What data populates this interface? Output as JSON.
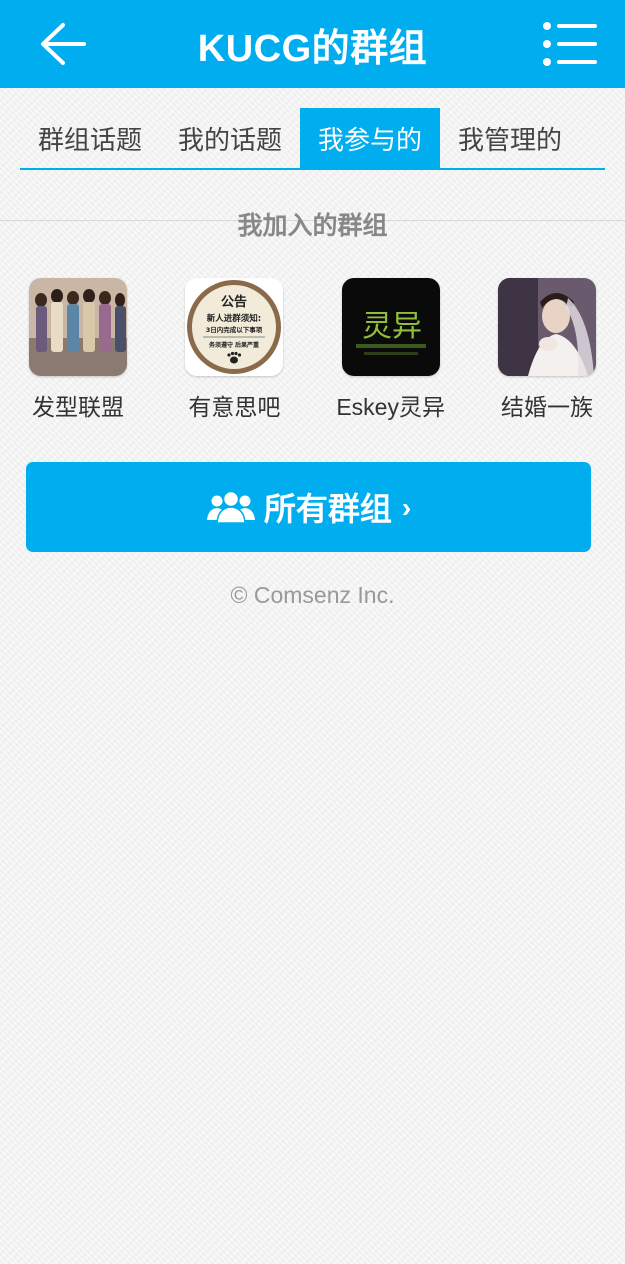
{
  "header": {
    "title": "KUCG的群组",
    "back_icon": "back-arrow-icon",
    "menu_icon": "menu-list-icon"
  },
  "tabs": [
    {
      "label": "群组话题",
      "active": false
    },
    {
      "label": "我的话题",
      "active": false
    },
    {
      "label": "我参与的",
      "active": true
    },
    {
      "label": "我管理的",
      "active": false
    }
  ],
  "section": {
    "title": "我加入的群组"
  },
  "groups": [
    {
      "name": "发型联盟",
      "icon": "group-photo-models"
    },
    {
      "name": "有意思吧",
      "icon": "group-notice-badge",
      "badge_title": "公告",
      "badge_line1": "新人进群须知:",
      "badge_line2": "3日内完成以下事项",
      "badge_line3": "务须遵守 后果严重"
    },
    {
      "name": "Eskey灵异",
      "icon": "group-eskey-logo",
      "logo_text": "灵异"
    },
    {
      "name": "结婚一族",
      "icon": "group-photo-bride"
    }
  ],
  "all_groups_button": {
    "label": "所有群组",
    "chevron": "›",
    "icon": "people-icon"
  },
  "footer": {
    "copyright": "© Comsenz Inc."
  },
  "colors": {
    "accent": "#00adef",
    "background": "#f3f3f3"
  }
}
